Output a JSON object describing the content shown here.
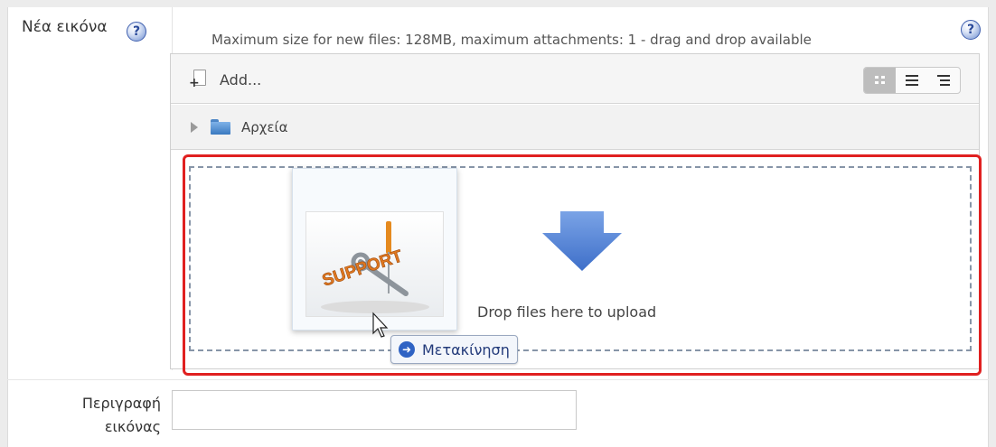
{
  "field": {
    "label": "Νέα εικόνα",
    "limits_text": "Maximum size for new files: 128MB, maximum attachments: 1 - drag and drop available",
    "help_glyph": "?"
  },
  "manager": {
    "add_label": "Add...",
    "view_modes": [
      "icons",
      "details",
      "tree"
    ],
    "active_view": "icons",
    "path_folder": "Αρχεία",
    "drop_text": "Drop files here to upload",
    "drag_tooltip": "Μετακίνηση",
    "dragged_image_text": "SUPPORT"
  },
  "description": {
    "label_line1": "Περιγραφή",
    "label_line2": "εικόνας",
    "value": ""
  },
  "colors": {
    "highlight_border": "#e02020",
    "dashed_border": "#8795a8",
    "arrow_blue": "#5b86d6",
    "tooltip_text": "#223a7a"
  }
}
